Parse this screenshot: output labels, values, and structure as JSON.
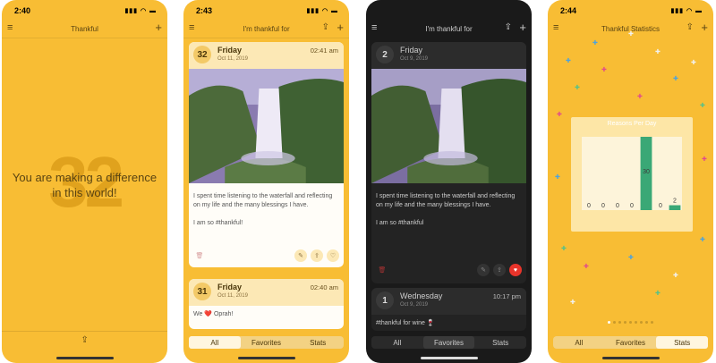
{
  "screen1": {
    "time": "2:40",
    "title": "Thankful",
    "big_number": "32",
    "message": "You are making a difference in this world!"
  },
  "screen2": {
    "time": "2:43",
    "title": "I'm thankful for",
    "card1": {
      "day": "32",
      "weekday": "Friday",
      "date": "Oct 11, 2019",
      "time": "02:41 am",
      "text1": "I spent time listening to the waterfall and reflecting on my life and the many blessings I have.",
      "text2": "I am so #thankful!"
    },
    "card2": {
      "day": "31",
      "weekday": "Friday",
      "date": "Oct 11, 2019",
      "time": "02:40 am",
      "text": "We ❤️ Oprah!"
    },
    "tabs": [
      "All",
      "Favorites",
      "Stats"
    ]
  },
  "screen3": {
    "title": "I'm thankful for",
    "card1": {
      "day": "2",
      "weekday": "Friday",
      "date": "Oct 9, 2019",
      "text1": "I spent time listening to the waterfall and reflecting on my life and the many blessings I have.",
      "text2": "I am so #thankful"
    },
    "card2": {
      "day": "1",
      "weekday": "Wednesday",
      "date": "Oct 9, 2019",
      "time": "10:17 pm",
      "text": "#thankful for wine 🍷"
    },
    "tabs": [
      "All",
      "Favorites",
      "Stats"
    ]
  },
  "screen4": {
    "time": "2:44",
    "title": "Thankful Statistics",
    "tabs": [
      "All",
      "Favorites",
      "Stats"
    ]
  },
  "chart_data": {
    "type": "bar",
    "title": "Reasons Per Day",
    "categories": [
      "1",
      "2",
      "3",
      "4",
      "5",
      "6",
      "7"
    ],
    "values": [
      0,
      0,
      0,
      0,
      30,
      0,
      2
    ],
    "ylim": [
      0,
      30
    ],
    "colors": {
      "bar": "#3aa876",
      "card": "#fde6a6",
      "label": "#3a3a3a"
    }
  },
  "colors": {
    "accent": "#f8bd34",
    "dark": "#1a1a1a",
    "heart": "#e8342b"
  }
}
